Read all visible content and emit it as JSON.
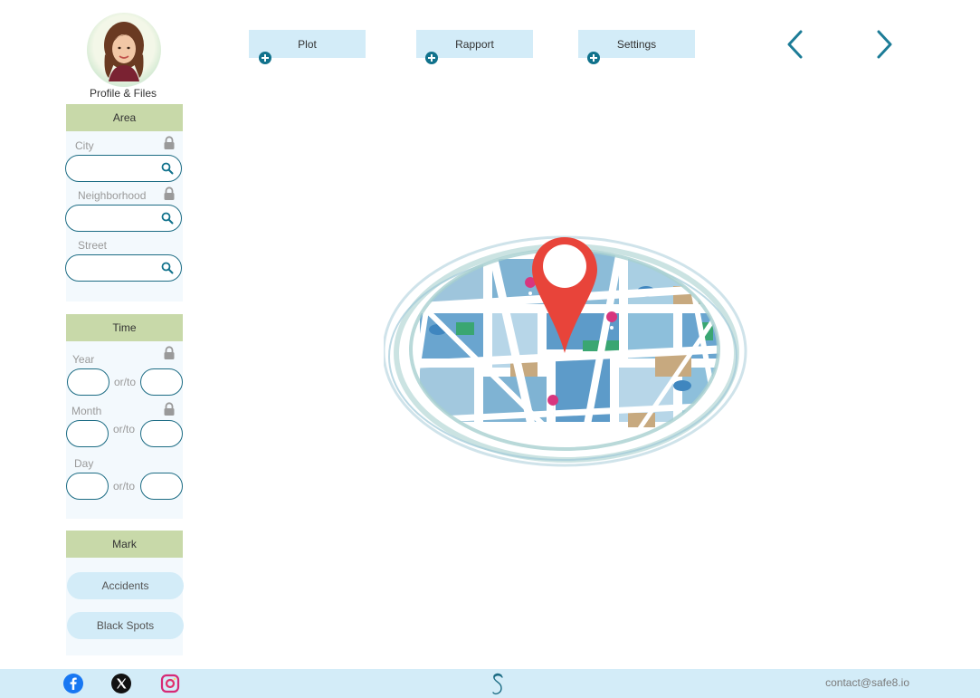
{
  "profile": {
    "label": "Profile & Files"
  },
  "area": {
    "header": "Area",
    "city_label": "City",
    "city_value": "",
    "neighborhood_label": "Neighborhood",
    "neighborhood_value": "",
    "street_label": "Street",
    "street_value": ""
  },
  "time": {
    "header": "Time",
    "year_label": "Year",
    "month_label": "Month",
    "day_label": "Day",
    "range_sep": "or/to"
  },
  "mark": {
    "header": "Mark",
    "accidents_label": "Accidents",
    "black_spots_label": "Black Spots"
  },
  "toolbar": {
    "plot_label": "Plot",
    "rapport_label": "Rapport",
    "settings_label": "Settings"
  },
  "navigation": {
    "back_icon": "chevron-left-icon",
    "forward_icon": "chevron-right-icon"
  },
  "footer": {
    "social_icons": [
      "facebook-icon",
      "x-icon",
      "instagram-icon"
    ],
    "contact": "contact@safe8.io"
  },
  "colors": {
    "accent": "#11728c",
    "panel_header": "#c8d9a9",
    "light_blue": "#d3ecf8",
    "pin_red": "#e8443a"
  }
}
